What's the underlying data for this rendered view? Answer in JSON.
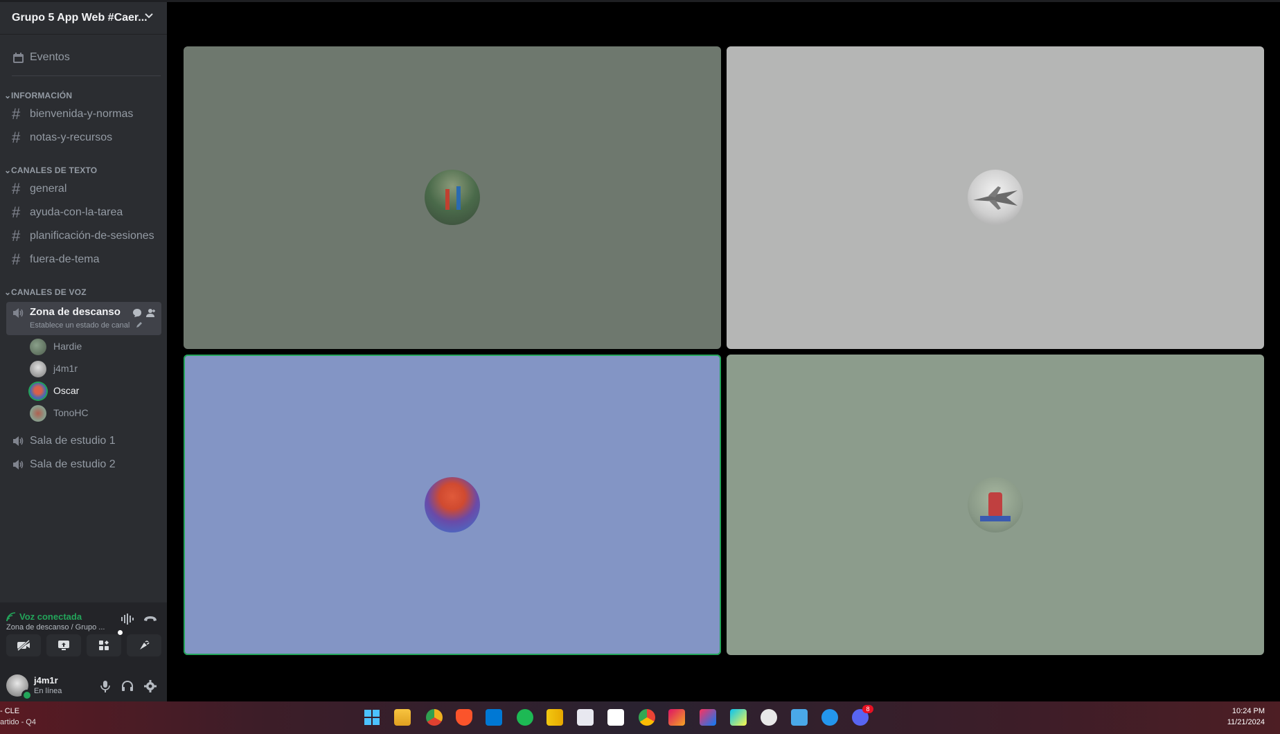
{
  "server": {
    "name": "Grupo 5 App Web #Caer..."
  },
  "events_label": "Eventos",
  "categories": {
    "info": "INFORMACIÓN",
    "text": "CANALES DE TEXTO",
    "voice": "CANALES DE VOZ"
  },
  "info_channels": [
    "bienvenida-y-normas",
    "notas-y-recursos"
  ],
  "text_channels": [
    "general",
    "ayuda-con-la-tarea",
    "planificación-de-sesiones",
    "fuera-de-tema"
  ],
  "voice_channels": {
    "active": {
      "name": "Zona de descanso",
      "status": "Establece un estado de canal"
    },
    "members": [
      "Hardie",
      "j4m1r",
      "Oscar",
      "TonoHC"
    ],
    "others": [
      "Sala de estudio 1",
      "Sala de estudio 2"
    ]
  },
  "voice_panel": {
    "status": "Voz conectada",
    "location": "Zona de descanso / Grupo ..."
  },
  "user_panel": {
    "name": "j4m1r",
    "status": "En línea"
  },
  "taskbar": {
    "left_line1": "- CLE",
    "left_line2": "artido - Q4",
    "time": "10:24 PM",
    "date": "11/21/2024",
    "discord_badge": "8"
  },
  "colors": {
    "sidebar": "#2b2d31",
    "voice_green": "#23a55a",
    "tile1": "#6e786e",
    "tile2": "#b5b6b5",
    "tile3": "#8395c5",
    "tile4": "#8c9c8c"
  }
}
